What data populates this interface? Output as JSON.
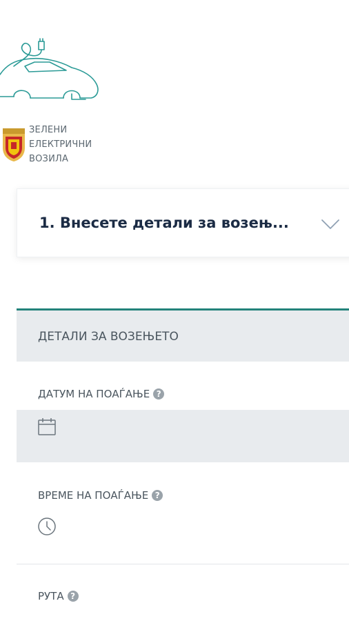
{
  "logo": {
    "lines": [
      "ЗЕЛЕНИ",
      "ЕЛЕКТРИЧНИ",
      "ВОЗИЛА"
    ],
    "icon": "electric-car-plug-icon",
    "crest_icon": "coat-of-arms-icon"
  },
  "step": {
    "title": "1. Внесете детали за возењ...",
    "chevron_icon": "chevron-down-icon"
  },
  "section": {
    "title": "ДЕТАЛИ ЗА ВОЗЕЊЕТО",
    "accent_color": "#23827a"
  },
  "fields": {
    "date_label": "ДАТУМ НА ПОАЃАЊЕ",
    "time_label": "ВРЕМЕ НА ПОАЃАЊЕ",
    "route_label": "РУТА",
    "date_value": "",
    "time_value": ""
  },
  "icons": {
    "help": "?",
    "calendar": "calendar-icon",
    "clock": "clock-icon"
  }
}
